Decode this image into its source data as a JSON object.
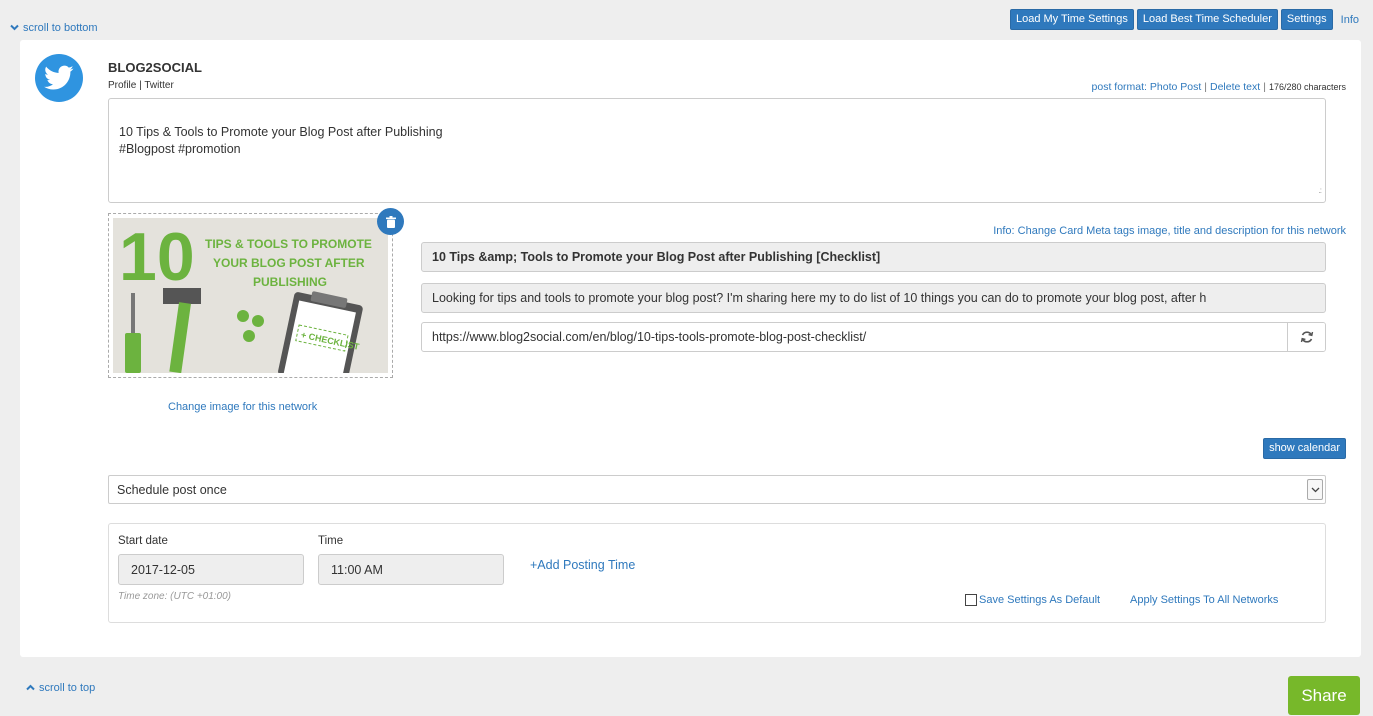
{
  "nav": {
    "scroll_bottom": "scroll to bottom",
    "scroll_top": "scroll to top"
  },
  "toolbar": {
    "load_my_time": "Load My Time Settings",
    "load_best_time": "Load Best Time Scheduler",
    "settings": "Settings",
    "info": "Info"
  },
  "network": {
    "name": "BLOG2SOCIAL",
    "profile_label": "Profile",
    "network_label": "Twitter",
    "icon": "twitter-bird-icon",
    "post_format": "post format: Photo Post",
    "delete_text": "Delete text",
    "char_count": "176/280 characters"
  },
  "post": {
    "text": "10 Tips & Tools to Promote your Blog Post after Publishing\n#Blogpost #promotion"
  },
  "image": {
    "change_label": "Change image for this network",
    "big_number": "10",
    "headline_1": "TIPS & TOOLS TO PROMOTE",
    "headline_2": "YOUR BLOG POST AFTER",
    "headline_3": "PUBLISHING",
    "checklist": "+ CHECKLIST"
  },
  "card_meta": {
    "info": "Info: Change Card Meta tags image, title and description for this network",
    "title": "10 Tips &amp; Tools to Promote your Blog Post after Publishing [Checklist]",
    "description": "Looking for tips and tools to promote your blog post? I'm sharing here my to do list of 10 things you can do to promote your blog post, after h",
    "url": "https://www.blog2social.com/en/blog/10-tips-tools-promote-blog-post-checklist/"
  },
  "schedule": {
    "show_calendar": "show calendar",
    "mode": "Schedule post once",
    "start_date_label": "Start date",
    "start_date": "2017-12-05",
    "time_label": "Time",
    "time": "11:00 AM",
    "add_time": "+Add Posting Time",
    "timezone": "Time zone: (UTC +01:00)",
    "save_default": "Save Settings As Default",
    "apply_all": "Apply Settings To All Networks"
  },
  "actions": {
    "share": "Share"
  },
  "colors": {
    "accent": "#2f79bd",
    "twitter": "#2f94e0",
    "share": "#77b82a",
    "image_green": "#6cb33f"
  }
}
